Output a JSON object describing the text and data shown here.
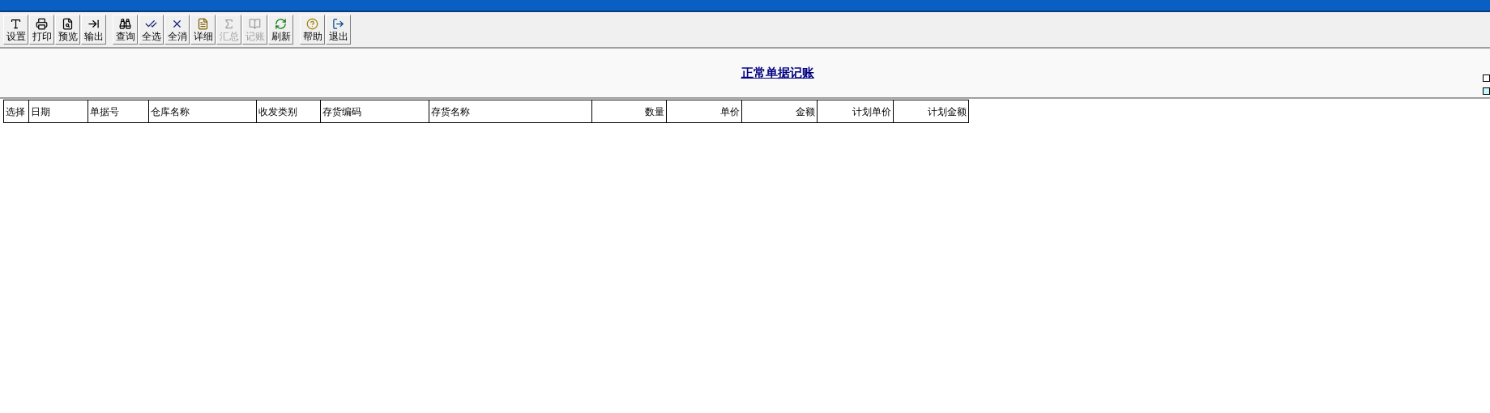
{
  "toolbar": {
    "groups": [
      [
        {
          "label": "设置",
          "kind": "settings",
          "disabled": false
        },
        {
          "label": "打印",
          "kind": "print",
          "disabled": false
        },
        {
          "label": "预览",
          "kind": "preview",
          "disabled": false
        },
        {
          "label": "输出",
          "kind": "export",
          "disabled": false
        }
      ],
      [
        {
          "label": "查询",
          "kind": "query",
          "disabled": false
        },
        {
          "label": "全选",
          "kind": "select_all",
          "disabled": false
        },
        {
          "label": "全消",
          "kind": "deselect_all",
          "disabled": false
        },
        {
          "label": "详细",
          "kind": "detail",
          "disabled": false
        },
        {
          "label": "汇总",
          "kind": "sum",
          "disabled": true
        },
        {
          "label": "记账",
          "kind": "post",
          "disabled": true
        },
        {
          "label": "刷新",
          "kind": "refresh",
          "disabled": false
        }
      ],
      [
        {
          "label": "帮助",
          "kind": "help",
          "disabled": false
        },
        {
          "label": "退出",
          "kind": "exit",
          "disabled": false
        }
      ]
    ]
  },
  "title": "正常单据记账",
  "table": {
    "columns": [
      {
        "label": "选择",
        "kind": "text"
      },
      {
        "label": "日期",
        "kind": "text"
      },
      {
        "label": "单据号",
        "kind": "text"
      },
      {
        "label": "仓库名称",
        "kind": "text"
      },
      {
        "label": "收发类别",
        "kind": "text"
      },
      {
        "label": "存货编码",
        "kind": "text"
      },
      {
        "label": "存货名称",
        "kind": "text"
      },
      {
        "label": "数量",
        "kind": "numeric"
      },
      {
        "label": "单价",
        "kind": "numeric"
      },
      {
        "label": "金额",
        "kind": "numeric"
      },
      {
        "label": "计划单价",
        "kind": "numeric"
      },
      {
        "label": "计划金额",
        "kind": "numeric"
      }
    ]
  }
}
